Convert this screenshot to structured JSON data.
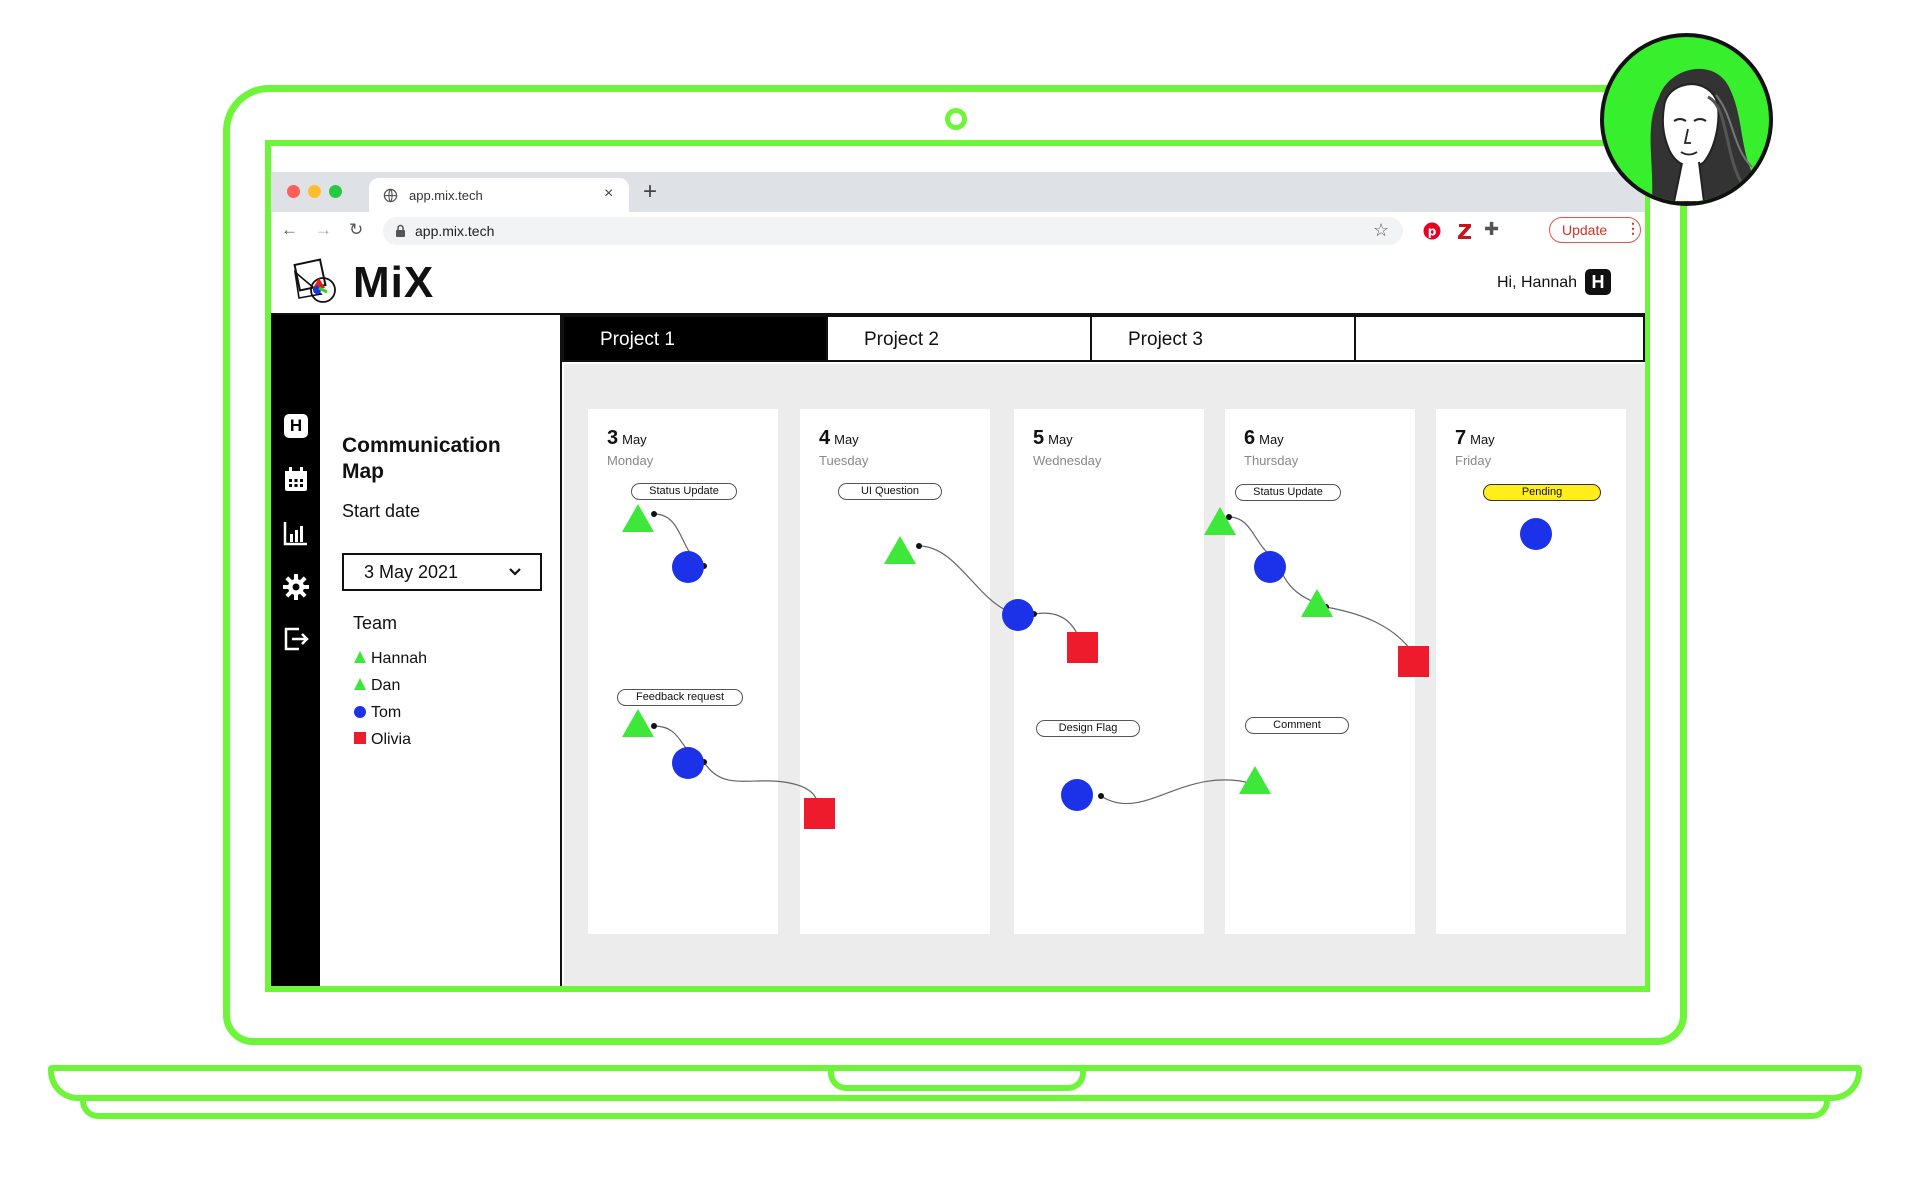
{
  "browser": {
    "tab_title": "app.mix.tech",
    "new_tab": "+",
    "tab_close": "×",
    "url": "app.mix.tech",
    "update_label": "Update"
  },
  "app": {
    "logo_text": "MiX",
    "greeting": "Hi, Hannah",
    "user_initial": "H"
  },
  "rail": {
    "home_initial": "H",
    "icons": [
      "home-icon",
      "calendar-icon",
      "chart-icon",
      "settings-gear-icon",
      "logout-icon"
    ]
  },
  "panel": {
    "title": "Communication Map",
    "start_label": "Start date",
    "start_value": "3 May 2021",
    "team_label": "Team",
    "team": [
      {
        "name": "Hannah",
        "shape": "triangle",
        "color": "#3ee83a"
      },
      {
        "name": "Dan",
        "shape": "triangle",
        "color": "#3ee83a"
      },
      {
        "name": "Tom",
        "shape": "circle",
        "color": "#1c32e8"
      },
      {
        "name": "Olivia",
        "shape": "square",
        "color": "#ed1b2b"
      }
    ]
  },
  "projects": {
    "tabs": [
      "Project 1",
      "Project 2",
      "Project 3",
      ""
    ],
    "active": 0
  },
  "board": {
    "days": [
      {
        "num": "3",
        "month": "May",
        "name": "Monday"
      },
      {
        "num": "4",
        "month": "May",
        "name": "Tuesday"
      },
      {
        "num": "5",
        "month": "May",
        "name": "Wednesday"
      },
      {
        "num": "6",
        "month": "May",
        "name": "Thursday"
      },
      {
        "num": "7",
        "month": "May",
        "name": "Friday"
      }
    ],
    "threads": {
      "status_update_1": "Status Update",
      "feedback_request": "Feedback request",
      "ui_question": "UI Question",
      "design_flag": "Design Flag",
      "status_update_2": "Status Update",
      "comment": "Comment",
      "pending": "Pending"
    }
  },
  "colors": {
    "accent_green": "#6ef53a",
    "triangle_green": "#3ee83a",
    "circle_blue": "#1c32e8",
    "square_red": "#ed1b2b",
    "pending_yellow": "#ffee1a"
  }
}
